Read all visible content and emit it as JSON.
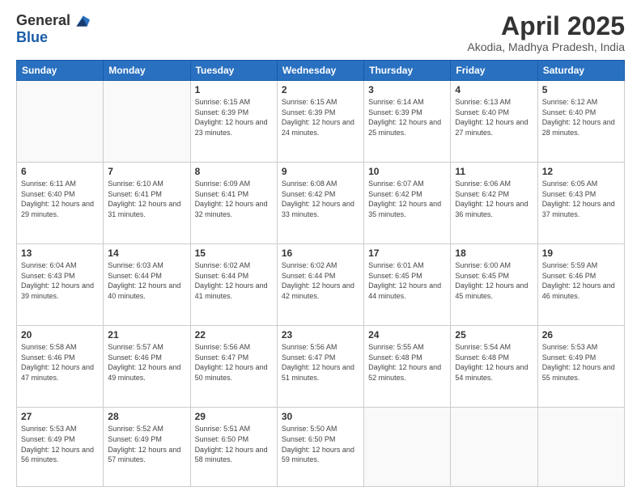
{
  "logo": {
    "general": "General",
    "blue": "Blue"
  },
  "header": {
    "month": "April 2025",
    "location": "Akodia, Madhya Pradesh, India"
  },
  "days_of_week": [
    "Sunday",
    "Monday",
    "Tuesday",
    "Wednesday",
    "Thursday",
    "Friday",
    "Saturday"
  ],
  "weeks": [
    [
      {
        "day": "",
        "sunrise": "",
        "sunset": "",
        "daylight": ""
      },
      {
        "day": "",
        "sunrise": "",
        "sunset": "",
        "daylight": ""
      },
      {
        "day": "1",
        "sunrise": "Sunrise: 6:15 AM",
        "sunset": "Sunset: 6:39 PM",
        "daylight": "Daylight: 12 hours and 23 minutes."
      },
      {
        "day": "2",
        "sunrise": "Sunrise: 6:15 AM",
        "sunset": "Sunset: 6:39 PM",
        "daylight": "Daylight: 12 hours and 24 minutes."
      },
      {
        "day": "3",
        "sunrise": "Sunrise: 6:14 AM",
        "sunset": "Sunset: 6:39 PM",
        "daylight": "Daylight: 12 hours and 25 minutes."
      },
      {
        "day": "4",
        "sunrise": "Sunrise: 6:13 AM",
        "sunset": "Sunset: 6:40 PM",
        "daylight": "Daylight: 12 hours and 27 minutes."
      },
      {
        "day": "5",
        "sunrise": "Sunrise: 6:12 AM",
        "sunset": "Sunset: 6:40 PM",
        "daylight": "Daylight: 12 hours and 28 minutes."
      }
    ],
    [
      {
        "day": "6",
        "sunrise": "Sunrise: 6:11 AM",
        "sunset": "Sunset: 6:40 PM",
        "daylight": "Daylight: 12 hours and 29 minutes."
      },
      {
        "day": "7",
        "sunrise": "Sunrise: 6:10 AM",
        "sunset": "Sunset: 6:41 PM",
        "daylight": "Daylight: 12 hours and 31 minutes."
      },
      {
        "day": "8",
        "sunrise": "Sunrise: 6:09 AM",
        "sunset": "Sunset: 6:41 PM",
        "daylight": "Daylight: 12 hours and 32 minutes."
      },
      {
        "day": "9",
        "sunrise": "Sunrise: 6:08 AM",
        "sunset": "Sunset: 6:42 PM",
        "daylight": "Daylight: 12 hours and 33 minutes."
      },
      {
        "day": "10",
        "sunrise": "Sunrise: 6:07 AM",
        "sunset": "Sunset: 6:42 PM",
        "daylight": "Daylight: 12 hours and 35 minutes."
      },
      {
        "day": "11",
        "sunrise": "Sunrise: 6:06 AM",
        "sunset": "Sunset: 6:42 PM",
        "daylight": "Daylight: 12 hours and 36 minutes."
      },
      {
        "day": "12",
        "sunrise": "Sunrise: 6:05 AM",
        "sunset": "Sunset: 6:43 PM",
        "daylight": "Daylight: 12 hours and 37 minutes."
      }
    ],
    [
      {
        "day": "13",
        "sunrise": "Sunrise: 6:04 AM",
        "sunset": "Sunset: 6:43 PM",
        "daylight": "Daylight: 12 hours and 39 minutes."
      },
      {
        "day": "14",
        "sunrise": "Sunrise: 6:03 AM",
        "sunset": "Sunset: 6:44 PM",
        "daylight": "Daylight: 12 hours and 40 minutes."
      },
      {
        "day": "15",
        "sunrise": "Sunrise: 6:02 AM",
        "sunset": "Sunset: 6:44 PM",
        "daylight": "Daylight: 12 hours and 41 minutes."
      },
      {
        "day": "16",
        "sunrise": "Sunrise: 6:02 AM",
        "sunset": "Sunset: 6:44 PM",
        "daylight": "Daylight: 12 hours and 42 minutes."
      },
      {
        "day": "17",
        "sunrise": "Sunrise: 6:01 AM",
        "sunset": "Sunset: 6:45 PM",
        "daylight": "Daylight: 12 hours and 44 minutes."
      },
      {
        "day": "18",
        "sunrise": "Sunrise: 6:00 AM",
        "sunset": "Sunset: 6:45 PM",
        "daylight": "Daylight: 12 hours and 45 minutes."
      },
      {
        "day": "19",
        "sunrise": "Sunrise: 5:59 AM",
        "sunset": "Sunset: 6:46 PM",
        "daylight": "Daylight: 12 hours and 46 minutes."
      }
    ],
    [
      {
        "day": "20",
        "sunrise": "Sunrise: 5:58 AM",
        "sunset": "Sunset: 6:46 PM",
        "daylight": "Daylight: 12 hours and 47 minutes."
      },
      {
        "day": "21",
        "sunrise": "Sunrise: 5:57 AM",
        "sunset": "Sunset: 6:46 PM",
        "daylight": "Daylight: 12 hours and 49 minutes."
      },
      {
        "day": "22",
        "sunrise": "Sunrise: 5:56 AM",
        "sunset": "Sunset: 6:47 PM",
        "daylight": "Daylight: 12 hours and 50 minutes."
      },
      {
        "day": "23",
        "sunrise": "Sunrise: 5:56 AM",
        "sunset": "Sunset: 6:47 PM",
        "daylight": "Daylight: 12 hours and 51 minutes."
      },
      {
        "day": "24",
        "sunrise": "Sunrise: 5:55 AM",
        "sunset": "Sunset: 6:48 PM",
        "daylight": "Daylight: 12 hours and 52 minutes."
      },
      {
        "day": "25",
        "sunrise": "Sunrise: 5:54 AM",
        "sunset": "Sunset: 6:48 PM",
        "daylight": "Daylight: 12 hours and 54 minutes."
      },
      {
        "day": "26",
        "sunrise": "Sunrise: 5:53 AM",
        "sunset": "Sunset: 6:49 PM",
        "daylight": "Daylight: 12 hours and 55 minutes."
      }
    ],
    [
      {
        "day": "27",
        "sunrise": "Sunrise: 5:53 AM",
        "sunset": "Sunset: 6:49 PM",
        "daylight": "Daylight: 12 hours and 56 minutes."
      },
      {
        "day": "28",
        "sunrise": "Sunrise: 5:52 AM",
        "sunset": "Sunset: 6:49 PM",
        "daylight": "Daylight: 12 hours and 57 minutes."
      },
      {
        "day": "29",
        "sunrise": "Sunrise: 5:51 AM",
        "sunset": "Sunset: 6:50 PM",
        "daylight": "Daylight: 12 hours and 58 minutes."
      },
      {
        "day": "30",
        "sunrise": "Sunrise: 5:50 AM",
        "sunset": "Sunset: 6:50 PM",
        "daylight": "Daylight: 12 hours and 59 minutes."
      },
      {
        "day": "",
        "sunrise": "",
        "sunset": "",
        "daylight": ""
      },
      {
        "day": "",
        "sunrise": "",
        "sunset": "",
        "daylight": ""
      },
      {
        "day": "",
        "sunrise": "",
        "sunset": "",
        "daylight": ""
      }
    ]
  ]
}
